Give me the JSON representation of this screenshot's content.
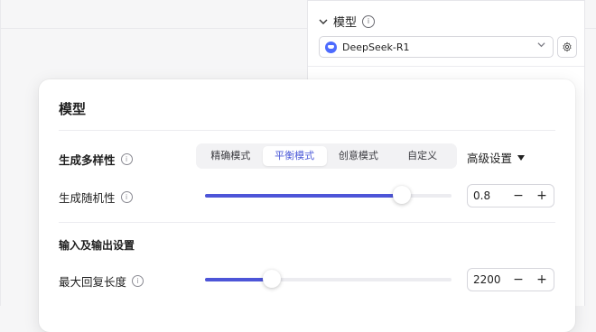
{
  "side_panel": {
    "section_title": "模型",
    "model_select": {
      "value": "DeepSeek-R1"
    }
  },
  "popup": {
    "title": "模型",
    "diversity": {
      "label": "生成多样性",
      "modes": [
        "精确模式",
        "平衡模式",
        "创意模式",
        "自定义"
      ],
      "active_mode": "平衡模式",
      "advanced_label": "高级设置"
    },
    "randomness": {
      "label": "生成随机性",
      "value": "0.8",
      "slider_fraction": 0.8
    },
    "io_section": {
      "title": "输入及输出设置"
    },
    "max_reply": {
      "label": "最大回复长度",
      "value": "2200",
      "slider_fraction": 0.27
    },
    "stepper_minus": "−",
    "stepper_plus": "+"
  },
  "colors": {
    "accent": "#4d55d8",
    "active_tab_text": "#4d5bd8",
    "logo": "#4d6bfe"
  },
  "icons": {
    "info": "info-icon",
    "chevron": "chevron-down-icon",
    "gear": "gear-icon",
    "caret": "caret-down-icon"
  }
}
